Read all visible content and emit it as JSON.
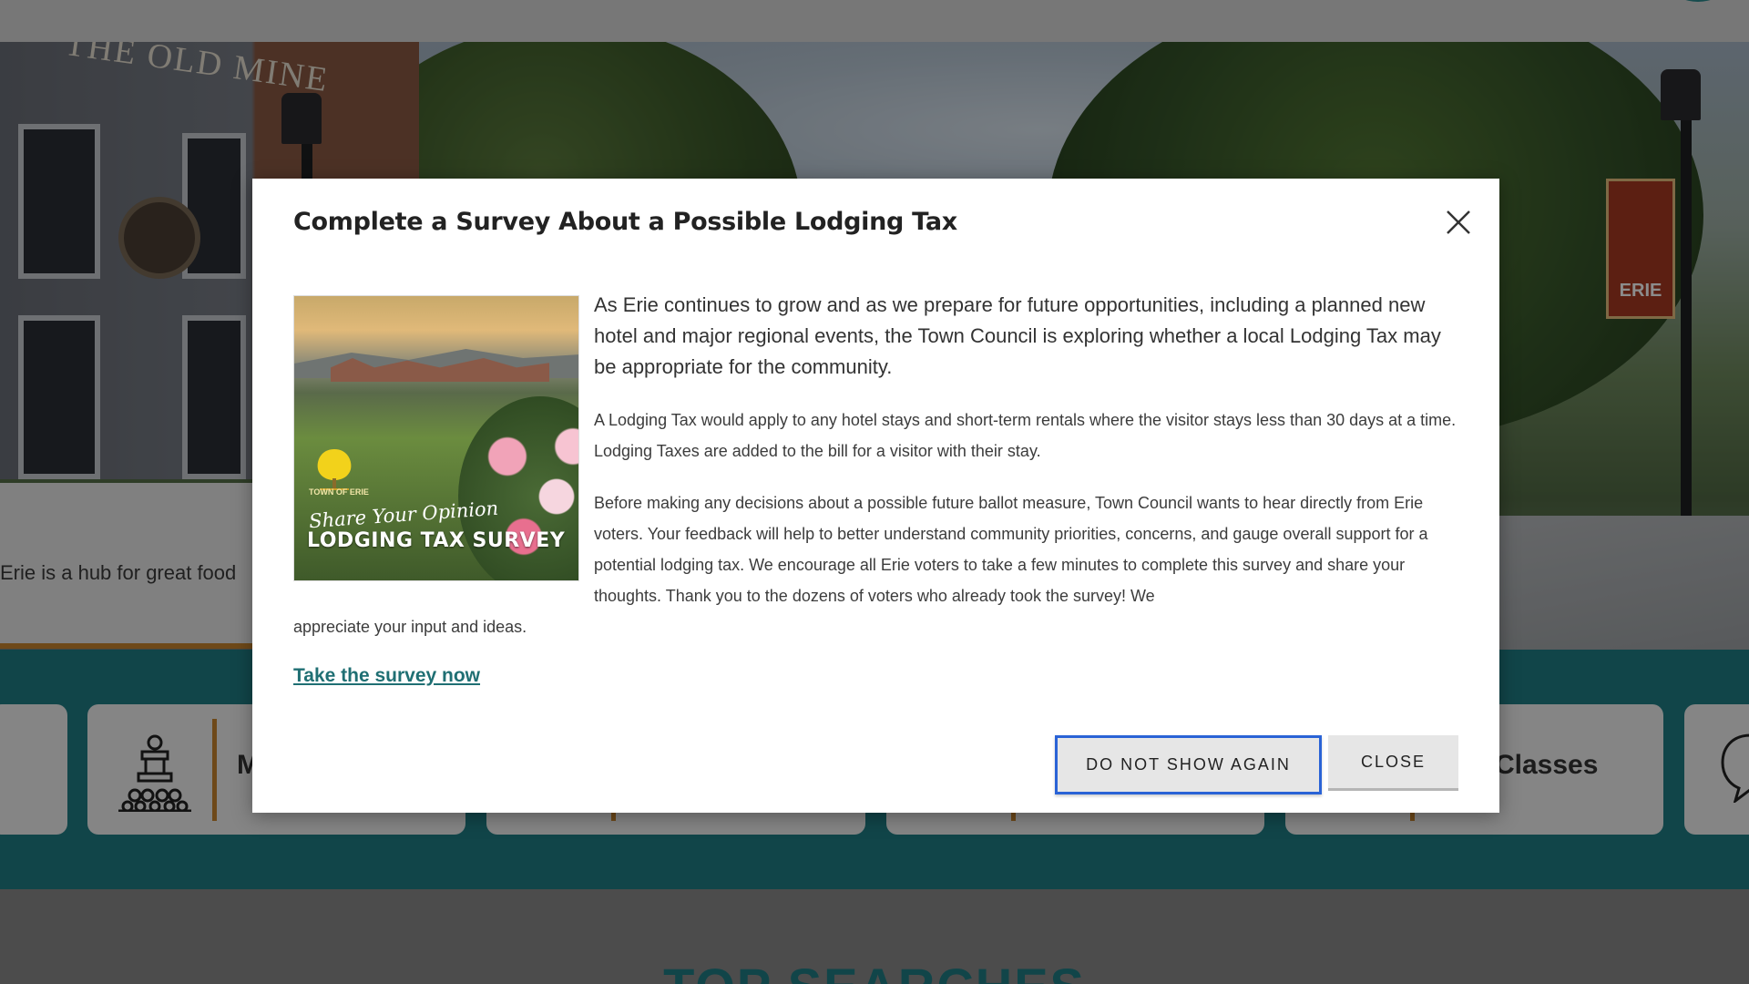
{
  "background": {
    "hero_sign": "THE OLD MINE",
    "banner_text": "ERIE",
    "intro_text": "Erie is a hub for great food",
    "tiles": [
      {
        "label": "M"
      },
      {
        "label": ""
      },
      {
        "label": ""
      },
      {
        "label": "Classes"
      },
      {
        "label": ""
      }
    ],
    "top_searches": "TOP SEARCHES"
  },
  "modal": {
    "title": "Complete a Survey About a Possible Lodging Tax",
    "promo_image": {
      "logo_text": "TOWN OF ERIE",
      "script_text": "Share Your Opinion",
      "headline": "LODGING TAX SURVEY"
    },
    "lead": "As Erie continues to grow and as we prepare for future opportunities, including a planned new hotel and major regional events, the Town Council is exploring whether a local Lodging Tax may be appropriate for the community.",
    "para1": "A Lodging Tax would apply to any hotel stays and short-term rentals where the visitor stays less than 30 days at a time. Lodging Taxes are added to the bill for a visitor with their stay.",
    "para2_main": "Before making any decisions about a possible future ballot measure, Town Council wants to hear directly from Erie voters. Your feedback will help to better understand community priorities, concerns, and gauge overall support for a potential lodging tax. We encourage all Erie voters to take a few minutes to complete this survey and share your thoughts. Thank you to the dozens of voters who already took the survey! We",
    "para2_tail": "appreciate your input and ideas.",
    "survey_link": "Take the survey now",
    "buttons": {
      "do_not_show": "DO NOT SHOW AGAIN",
      "close": "CLOSE"
    },
    "close_icon": "close-x-icon"
  },
  "colors": {
    "teal": "#1f7e86",
    "accent": "#c8862f",
    "link": "#1f6f73",
    "focus": "#2a63d6"
  }
}
